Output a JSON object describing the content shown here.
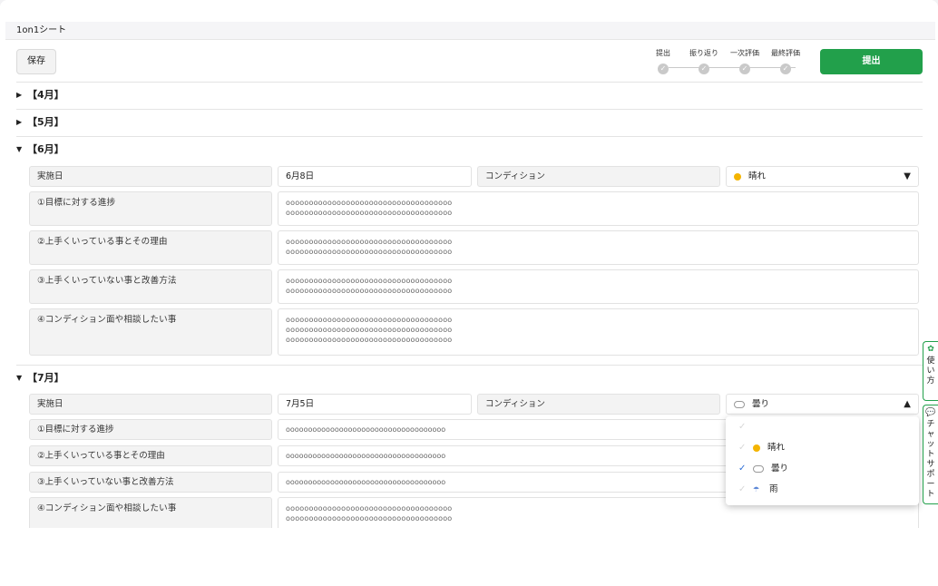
{
  "header": {
    "title": "1on1シート",
    "save_label": "保存",
    "submit_label": "提出"
  },
  "steps": [
    "提出",
    "振り返り",
    "一次評価",
    "最終評価"
  ],
  "collapsed_sections": [
    "【4月】",
    "【5月】"
  ],
  "june": {
    "title": "【6月】",
    "date_label": "実施日",
    "date_value": "6月8日",
    "condition_label": "コンディション",
    "condition_value": "晴れ",
    "rows": [
      {
        "label": "①目標に対する進捗",
        "lines": [
          "oooooooooooooooooooooooooooooooooooo",
          "oooooooooooooooooooooooooooooooooooo"
        ]
      },
      {
        "label": "②上手くいっている事とその理由",
        "lines": [
          "oooooooooooooooooooooooooooooooooooo",
          "oooooooooooooooooooooooooooooooooooo"
        ]
      },
      {
        "label": "③上手くいっていない事と改善方法",
        "lines": [
          "oooooooooooooooooooooooooooooooooooo",
          "oooooooooooooooooooooooooooooooooooo"
        ]
      },
      {
        "label": "④コンディション面や相談したい事",
        "lines": [
          "oooooooooooooooooooooooooooooooooooo",
          "oooooooooooooooooooooooooooooooooooo",
          "oooooooooooooooooooooooooooooooooooo"
        ]
      }
    ]
  },
  "july": {
    "title": "【7月】",
    "date_label": "実施日",
    "date_value": "7月5日",
    "condition_label": "コンディション",
    "condition_value": "曇り",
    "rows": [
      {
        "label": "①目標に対する進捗",
        "lines": [
          "oooooooooooooooooooooooooooooooooooo"
        ]
      },
      {
        "label": "②上手くいっている事とその理由",
        "lines": [
          "oooooooooooooooooooooooooooooooooooo"
        ]
      },
      {
        "label": "③上手くいっていない事と改善方法",
        "lines": [
          "oooooooooooooooooooooooooooooooooooo"
        ]
      },
      {
        "label": "④コンディション面や相談したい事",
        "lines": [
          "oooooooooooooooooooooooooooooooooooo",
          "oooooooooooooooooooooooooooooooooooo"
        ]
      }
    ]
  },
  "dropdown": {
    "options": [
      "",
      "晴れ",
      "曇り",
      "雨"
    ],
    "selected": "曇り"
  },
  "side_tabs": {
    "usage": "使い方",
    "chat": "チャットサポート"
  },
  "colors": {
    "accent": "#22a04b",
    "check": "#2f6fd6"
  }
}
